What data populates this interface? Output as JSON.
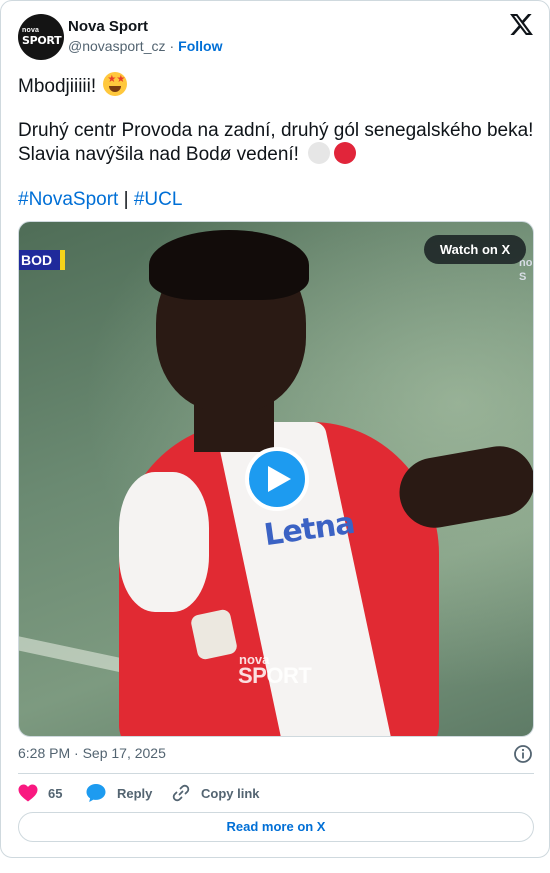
{
  "author": {
    "name": "Nova Sport",
    "handle": "@novasport_cz",
    "separator": "·",
    "follow_label": "Follow",
    "avatar_text_top": "nova",
    "avatar_text_bottom": "SPORT"
  },
  "tweet": {
    "line1": "Mbodjiiiii!",
    "line2": "Druhý centr Provoda na zadní, druhý gól senegalského beka!",
    "line3": "Slavia navýšila nad Bodø vedení!",
    "hashtag1": "#NovaSport",
    "hashtag_separator": " | ",
    "hashtag2": "#UCL"
  },
  "media": {
    "watch_label": "Watch on X",
    "score_badge": "BOD",
    "watermark_top": "nova",
    "watermark_bottom": "SPORT",
    "sponsor_text": "Letna",
    "edge_logo_line1": "no",
    "edge_logo_line2": "S",
    "play_icon": "play-icon"
  },
  "meta": {
    "timestamp": "6:28 PM · Sep 17, 2025",
    "info_icon": "info-icon"
  },
  "actions": {
    "like_count": "65",
    "reply_label": "Reply",
    "copy_label": "Copy link"
  },
  "footer": {
    "read_more_label": "Read more on X"
  },
  "colors": {
    "link": "#006fd6",
    "like": "#f91880",
    "reply_bubble": "#1d9bf0",
    "muted": "#536471",
    "border": "#cfd9de"
  }
}
